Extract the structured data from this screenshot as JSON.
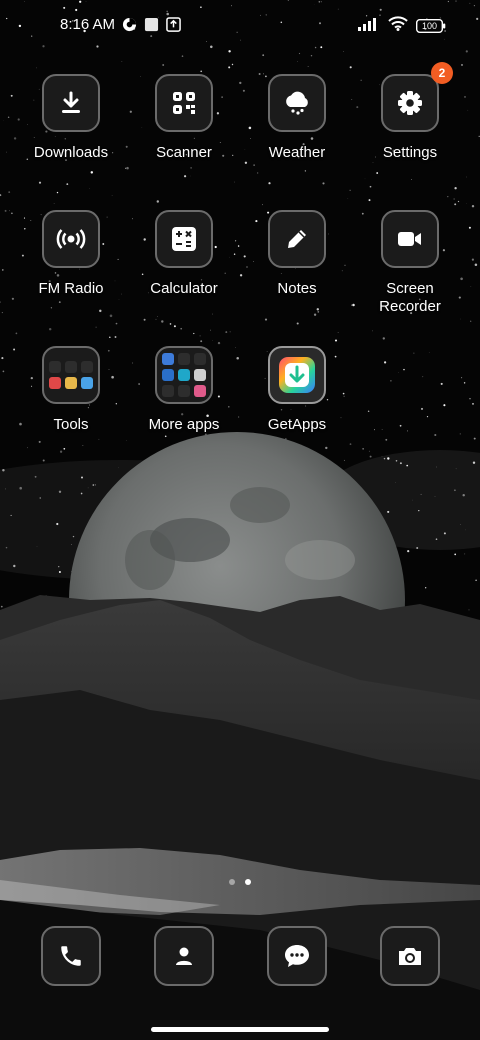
{
  "status_bar": {
    "time": "8:16 AM",
    "battery": "100",
    "icons": [
      "data-saver-icon",
      "notification-square-icon",
      "download-notification-icon",
      "signal-icon",
      "wifi-icon",
      "battery-icon"
    ]
  },
  "apps": [
    {
      "label": "Downloads",
      "icon": "download-icon"
    },
    {
      "label": "Scanner",
      "icon": "qr-scanner-icon"
    },
    {
      "label": "Weather",
      "icon": "weather-cloud-icon"
    },
    {
      "label": "Settings",
      "icon": "gear-icon",
      "badge": "2"
    },
    {
      "label": "FM Radio",
      "icon": "radio-icon"
    },
    {
      "label": "Calculator",
      "icon": "calculator-icon"
    },
    {
      "label": "Notes",
      "icon": "pencil-icon"
    },
    {
      "label": "Screen\nRecorder",
      "icon": "video-camera-icon"
    },
    {
      "label": "Tools",
      "icon": "folder-icon"
    },
    {
      "label": "More apps",
      "icon": "folder-icon"
    },
    {
      "label": "GetApps",
      "icon": "getapps-icon"
    }
  ],
  "page_indicator": {
    "pages": 2,
    "active": 2
  },
  "dock": [
    {
      "icon": "phone-icon"
    },
    {
      "icon": "contacts-icon"
    },
    {
      "icon": "messages-icon"
    },
    {
      "icon": "camera-icon"
    }
  ],
  "colors": {
    "badge": "#f25d23",
    "icon_bg": "#1b1b1b",
    "icon_border": "#6b6b6b"
  }
}
